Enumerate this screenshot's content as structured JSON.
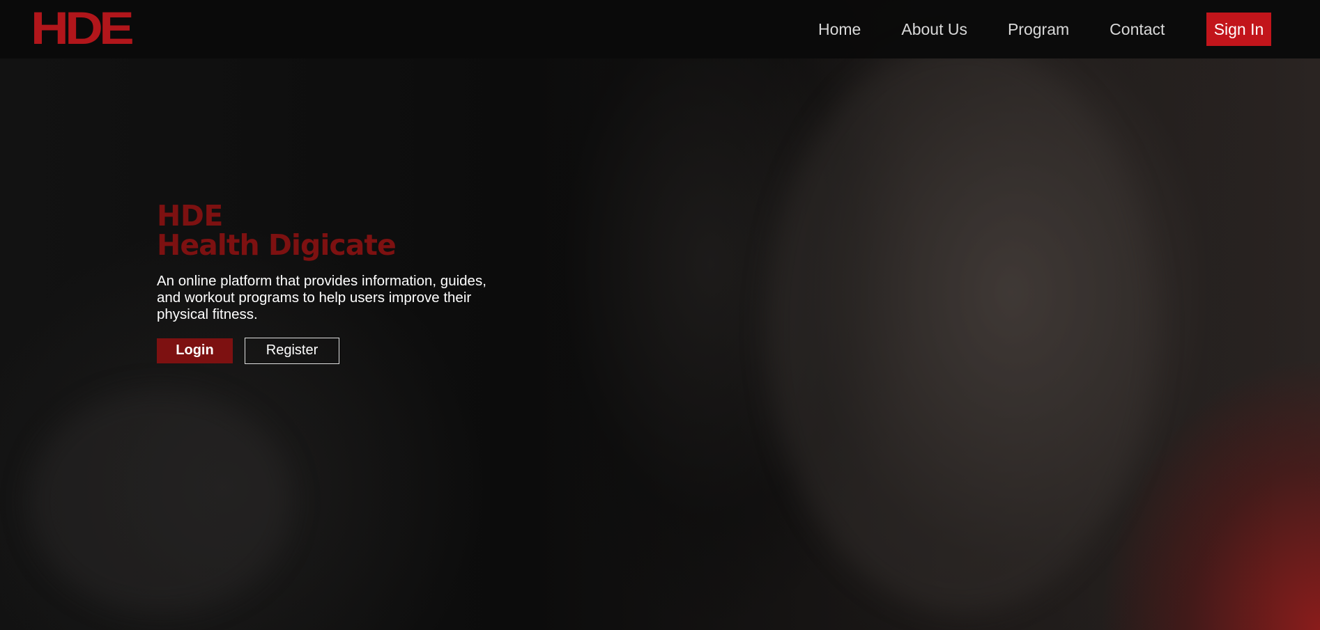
{
  "header": {
    "logo_text": "HDE",
    "nav": {
      "home": "Home",
      "about": "About Us",
      "program": "Program",
      "contact": "Contact"
    },
    "sign_in_label": "Sign In"
  },
  "hero": {
    "brand": "HDE",
    "brand_name": "Health Digicate",
    "description": "An online platform that provides information, guides, and workout programs to help users improve their physical fitness.",
    "login_label": "Login",
    "register_label": "Register"
  },
  "colors": {
    "accent": "#c2151b",
    "brand_dark_red": "#7d1111",
    "background": "#0a0a0a"
  },
  "background_image": "gym-athlete-photo"
}
